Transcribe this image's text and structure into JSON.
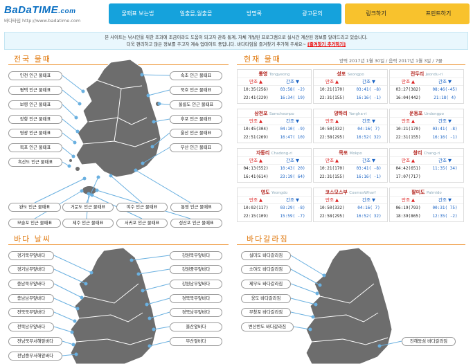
{
  "header": {
    "logo_text": "BaDaTIME",
    "logo_domain": ".com",
    "logo_sub": "바다타임 http://www.badatime.com",
    "nav": [
      "물때표 보는법",
      "일출몰,월출몰",
      "방명록",
      "광고문의"
    ],
    "nav_right": [
      "링크하기",
      "프린트하기"
    ]
  },
  "notice": {
    "line1": "본 사이트는 낚시인을 위한 조과에 조금이라도 도움이 되고자 관측 통계, 자체 개발된 프로그램으로 실시간 계산된 정보를 알려드리고 있습니다.",
    "line2": "더욱 편리하고 많은 정보를 주고자 계속 업데이트 중입니다. 바다타임을 즐겨찾기 추가해 주세요~",
    "link": "[즐겨찾기 추가하기]"
  },
  "sections": {
    "national": "전국 물때",
    "current": "현재 물때",
    "weather": "바다 날씨",
    "fishing": "바다갈라짐"
  },
  "date_text": "양력 2017년 1월 30일 / 음력 2017년 1월 3일 / 7물",
  "national_buttons": {
    "left": [
      "인천 인근 물때표",
      "평택 인근 물때표",
      "보령 인근 물때표",
      "장항 인근 물때표",
      "영광 인근 물때표",
      "목포 인근 물때표",
      "흑산도 인근 물때표"
    ],
    "right": [
      "속초 인근 물때표",
      "묵호 인근 물때표",
      "울릉도 인근 물때표",
      "후포 인근 물때표",
      "울산 인근 물때표",
      "부산 인근 물때표"
    ],
    "row1": [
      "완도 인근 물때표",
      "거문도 인근 물때표",
      "여수 인근 물때표",
      "통영 인근 물때표"
    ],
    "row2": [
      "모슬포 인근 물때표",
      "제주 인근 물때표",
      "서귀포 인근 물때표",
      "성산포 인근 물때표"
    ]
  },
  "tide_header": {
    "high": "만조 ▲",
    "low": "간조 ▼"
  },
  "tides": [
    {
      "name": "통영",
      "roman": "Tongyeong",
      "r1": [
        "10:35(256)",
        "03:58( -2)"
      ],
      "r2": [
        "22:41(229)",
        "16:34( 19)"
      ]
    },
    {
      "name": "성포",
      "roman": "Seongpo",
      "r1": [
        "10:21(170)",
        "03:41( -8)"
      ],
      "r2": [
        "22:31(155)",
        "16:16( -1)"
      ]
    },
    {
      "name": "전두리",
      "roman": "Jeondu-ri",
      "r1": [
        "03:27(382)",
        "08:46(-45)"
      ],
      "r2": [
        "16:04(442)",
        "21:18(  4)"
      ]
    },
    {
      "name": "삼천포",
      "roman": "Samcheonpo",
      "r1": [
        "10:45(304)",
        "04:10( -9)"
      ],
      "r2": [
        "22:51(269)",
        "16:47( 10)"
      ]
    },
    {
      "name": "양하리",
      "roman": "Yangha-ri",
      "r1": [
        "10:50(332)",
        "04:16(  7)"
      ],
      "r2": [
        "22:58(295)",
        "16:52( 32)"
      ]
    },
    {
      "name": "운동포",
      "roman": "Undongpo",
      "r1": [
        "10:21(170)",
        "03:41( -8)"
      ],
      "r2": [
        "22:31(155)",
        "16:16( -1)"
      ]
    },
    {
      "name": "자동리",
      "roman": "Chadong-ri",
      "r1": [
        "04:13(552)",
        "10:43( 20)"
      ],
      "r2": [
        "16:41(614)",
        "23:19( 64)"
      ]
    },
    {
      "name": "목포",
      "roman": "Mokpo",
      "r1": [
        "10:21(170)",
        "03:41( -8)"
      ],
      "r2": [
        "22:31(155)",
        "16:16( -1)"
      ]
    },
    {
      "name": "창리",
      "roman": "Chang-ri",
      "r1": [
        "04:42(651)",
        "11:35( 34)"
      ],
      "r2": [
        "17:07(717)",
        ""
      ]
    },
    {
      "name": "영도",
      "roman": "Yeongdo",
      "r1": [
        "10:02(117)",
        "03:29( -8)"
      ],
      "r2": [
        "22:15(109)",
        "15:59( -7)"
      ]
    },
    {
      "name": "코스모스부",
      "roman": "CosmosWharf",
      "r1": [
        "10:50(332)",
        "04:16(  7)"
      ],
      "r2": [
        "22:58(295)",
        "16:52( 32)"
      ]
    },
    {
      "name": "팔미도",
      "roman": "Palmido",
      "r1": [
        "06:19(793)",
        "00:31( 75)"
      ],
      "r2": [
        "18:39(865)",
        "12:35( -2)"
      ]
    }
  ],
  "weather_buttons": {
    "left": [
      "경기북부앞바다",
      "경기남부앞바다",
      "충남북부앞바다",
      "충남남부앞바다",
      "전북북부앞바다",
      "전북남부앞바다",
      "전남북부서해앞바다",
      "전남중부서해앞바다"
    ],
    "right": [
      "강원북부앞바다",
      "강원중부앞바다",
      "강원남부앞바다",
      "경북북부앞바다",
      "경북남부앞바다",
      "울산앞바다",
      "부산앞바다"
    ]
  },
  "fishing_buttons": {
    "left": [
      "실미도 바다갈라짐",
      "소야도 바다갈라짐",
      "제부도 바다갈라짐",
      "웅도 바다갈라짐",
      "무창포 바다갈라짐",
      "변산반도 바다갈라짐"
    ],
    "right": [
      "진해동섬 바다갈라짐"
    ]
  },
  "colors": {
    "accent": "#e07a10",
    "nav_blue": "#15a2dc",
    "nav_yellow": "#f8c22d",
    "map_gray": "#6d6d6d"
  }
}
